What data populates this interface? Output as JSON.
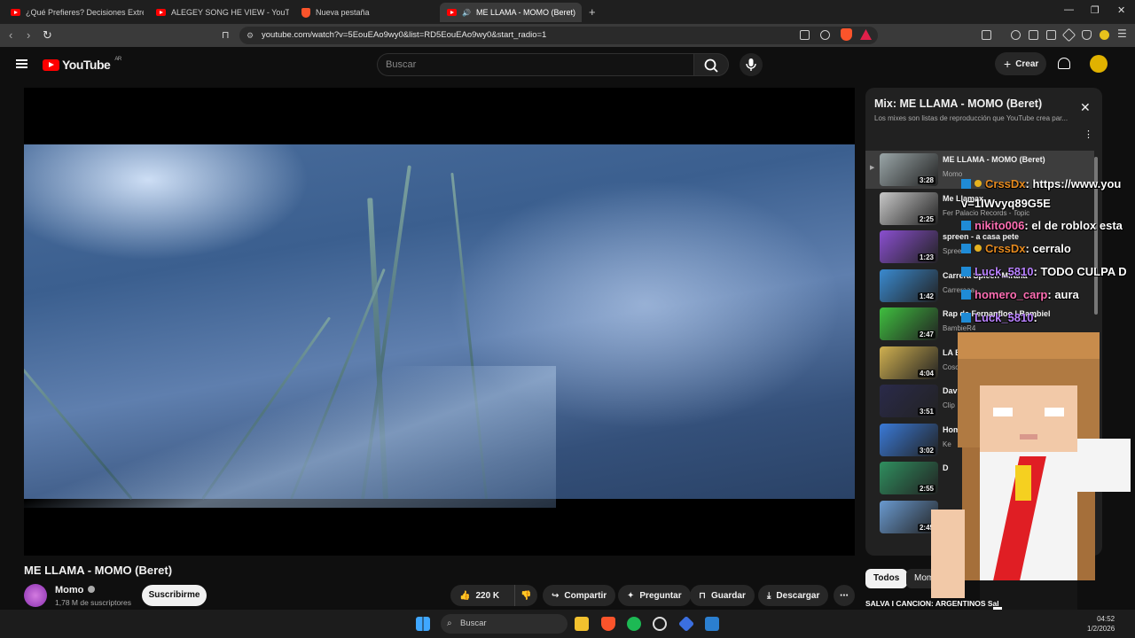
{
  "tabs": [
    {
      "title": "¿Qué Prefieres? Decisiones Extremas",
      "active": false
    },
    {
      "title": "ALEGEY SONG HE VIEW - YouTube",
      "active": false
    },
    {
      "title": "Nueva pestaña",
      "active": false
    },
    {
      "title": "ME LLAMA - MOMO (Beret)",
      "active": true
    }
  ],
  "address": {
    "url": "youtube.com/watch?v=5EouEAo9wy0&list=RD5EouEAo9wy0&start_radio=1"
  },
  "header": {
    "logo_text": "YouTube",
    "region": "AR",
    "search_placeholder": "Buscar",
    "create_label": "Crear"
  },
  "video": {
    "title": "ME LLAMA - MOMO (Beret)",
    "channel": "Momo",
    "subscribers": "1,78 M de suscriptores",
    "subscribe_label": "Suscribirme",
    "likes": "220 K",
    "share_label": "Compartir",
    "ask_label": "Preguntar",
    "save_label": "Guardar",
    "download_label": "Descargar"
  },
  "playlist": {
    "title": "Mix: ME LLAMA - MOMO (Beret)",
    "subtitle": "Los mixes son listas de reproducción que YouTube crea par...",
    "items": [
      {
        "title": "ME LLAMA - MOMO (Beret)",
        "channel": "Momo",
        "duration": "3:28",
        "color": "#9aa6a8"
      },
      {
        "title": "Me Llamax",
        "channel": "Fer Palacio Records - Topic",
        "duration": "2:25",
        "color": "#c8c8c8"
      },
      {
        "title": "spreen - a casa pete",
        "channel": "Spreen",
        "duration": "1:23",
        "color": "#8a4fd0"
      },
      {
        "title": "Carrera Spleen Mirana",
        "channel": "Carreraaa",
        "duration": "1:42",
        "color": "#3a8ad0"
      },
      {
        "title": "Rap de Fernanfloo | Bambiel",
        "channel": "BambieR4",
        "duration": "2:47",
        "color": "#3fbf3f"
      },
      {
        "title": "LA BHAV",
        "channel": "Coscu",
        "duration": "4:04",
        "color": "#d0b050"
      },
      {
        "title": "Dav",
        "channel": "Clip",
        "duration": "3:51",
        "color": "#2a2a4a"
      },
      {
        "title": "Hom Gri",
        "channel": "Ke",
        "duration": "3:02",
        "color": "#3a7ad8"
      },
      {
        "title": "D",
        "channel": "",
        "duration": "2:55",
        "color": "#2f8f5f"
      },
      {
        "title": "",
        "channel": "",
        "duration": "2:45",
        "color": "#6a9ad0"
      }
    ]
  },
  "chips": [
    "Todos",
    "Momo"
  ],
  "chat": [
    {
      "user": "CrssDx",
      "msg": ": https://www.you"
    },
    {
      "user": "",
      "msg": "v=1IWvyq89G5E"
    },
    {
      "user": "nikito006",
      "msg": ": el de roblox esta"
    },
    {
      "user": "CrssDx",
      "msg": ": cerralo"
    },
    {
      "user": "Luck_5810",
      "msg": ": TODO CULPA D"
    },
    {
      "user": "homero_carp",
      "msg": ": aura"
    },
    {
      "user": "Luck_5810",
      "msg": ":"
    }
  ],
  "bottom_ticker": "SALVA I CANCION: ARGENTINOS  Sal",
  "taskbar": {
    "search_label": "Buscar",
    "time": "04:52",
    "date": "1/2/2026"
  },
  "colors": {
    "accent": "#ff0000",
    "bg": "#0f0f0f",
    "panel": "#212121"
  }
}
